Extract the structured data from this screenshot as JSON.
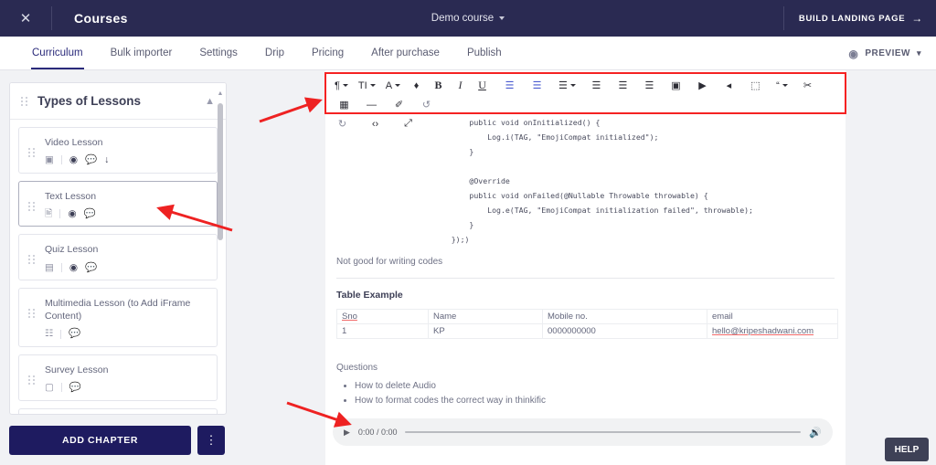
{
  "topbar": {
    "close_icon": "close-icon",
    "title": "Courses",
    "course_selector": "Demo course",
    "build_landing_page": "BUILD LANDING PAGE",
    "arrow_icon": "arrow-right-icon",
    "bg_color": "#2a2a52"
  },
  "nav": {
    "tabs": [
      {
        "label": "Curriculum",
        "active": true
      },
      {
        "label": "Bulk importer",
        "active": false
      },
      {
        "label": "Settings",
        "active": false
      },
      {
        "label": "Drip",
        "active": false
      },
      {
        "label": "Pricing",
        "active": false
      },
      {
        "label": "After purchase",
        "active": false
      },
      {
        "label": "Publish",
        "active": false
      }
    ],
    "preview_label": "PREVIEW",
    "preview_eye_icon": "eye-icon",
    "preview_chevron_icon": "chevron-down-icon",
    "accent_color": "#2a2a7a"
  },
  "sidebar": {
    "chapter_title": "Types of Lessons",
    "collapse_icon": "chevron-up-icon",
    "drag_icon": "drag-handle-icon",
    "lessons": [
      {
        "name": "Video Lesson",
        "selected": false,
        "icons": [
          "video-camera-icon",
          "eye-icon",
          "comment-icon",
          "download-icon"
        ]
      },
      {
        "name": "Text Lesson",
        "selected": true,
        "icons": [
          "document-icon",
          "eye-icon",
          "comment-icon"
        ]
      },
      {
        "name": "Quiz Lesson",
        "selected": false,
        "icons": [
          "quiz-icon",
          "eye-icon",
          "comment-icon"
        ]
      },
      {
        "name": "Multimedia Lesson (to Add iFrame Content)",
        "selected": false,
        "icons": [
          "multimedia-icon",
          "comment-icon"
        ]
      },
      {
        "name": "Survey Lesson",
        "selected": false,
        "icons": [
          "survey-icon",
          "comment-icon"
        ]
      }
    ],
    "add_chapter_label": "ADD CHAPTER",
    "kebab_icon": "more-vertical-icon"
  },
  "toolbar": {
    "highlight_color": "#f52222",
    "row1": [
      {
        "name": "paragraph-format-button",
        "glyph": "¶",
        "caret": true,
        "style": "dark"
      },
      {
        "name": "font-size-button",
        "glyph": "TІ",
        "caret": true,
        "style": "dark"
      },
      {
        "name": "font-family-button",
        "glyph": "A",
        "caret": true,
        "style": "dark"
      },
      {
        "name": "text-color-button",
        "glyph": "♦",
        "caret": false,
        "style": "dark"
      },
      {
        "name": "bold-button",
        "glyph": "B",
        "caret": false,
        "style": "dark"
      },
      {
        "name": "italic-button",
        "glyph": "I",
        "caret": false,
        "style": "dark"
      },
      {
        "name": "underline-button",
        "glyph": "U",
        "caret": false,
        "style": "dark"
      },
      {
        "name": "unordered-list-button",
        "glyph": "☰",
        "caret": false,
        "style": "blue"
      },
      {
        "name": "ordered-list-button",
        "glyph": "☰",
        "caret": false,
        "style": "blue"
      },
      {
        "name": "align-button",
        "glyph": "☰",
        "caret": true,
        "style": "dark"
      },
      {
        "name": "indent-increase-button",
        "glyph": "☰",
        "caret": false,
        "style": "dark"
      },
      {
        "name": "indent-decrease-button",
        "glyph": "☰",
        "caret": false,
        "style": "dark"
      },
      {
        "name": "outdent-button",
        "glyph": "☰",
        "caret": false,
        "style": "dark"
      },
      {
        "name": "insert-image-button",
        "glyph": "▣",
        "caret": false,
        "style": "dark"
      },
      {
        "name": "insert-video-button",
        "glyph": "▶",
        "caret": false,
        "style": "dark"
      },
      {
        "name": "insert-audio-button",
        "glyph": "◂",
        "caret": false,
        "style": "dark"
      },
      {
        "name": "insert-file-button",
        "glyph": "⬚",
        "caret": false,
        "style": "dark"
      },
      {
        "name": "quote-button",
        "glyph": "“",
        "caret": true,
        "style": "dark"
      },
      {
        "name": "insert-link-button",
        "glyph": "✂",
        "caret": false,
        "style": "dark"
      },
      {
        "name": "insert-table-button",
        "glyph": "▦",
        "caret": false,
        "style": "dark"
      },
      {
        "name": "horizontal-line-button",
        "glyph": "—",
        "caret": false,
        "style": "dark"
      },
      {
        "name": "clear-formatting-button",
        "glyph": "✐",
        "caret": false,
        "style": "dark"
      },
      {
        "name": "undo-button",
        "glyph": "↺",
        "caret": false,
        "style": "grey"
      }
    ],
    "row2": [
      {
        "name": "redo-button",
        "glyph": "↻",
        "caret": false,
        "style": "grey"
      },
      {
        "name": "code-view-button",
        "glyph": "‹›",
        "caret": false,
        "style": "dark"
      },
      {
        "name": "fullscreen-button",
        "glyph": "⤢",
        "caret": false,
        "style": "dark"
      }
    ]
  },
  "document": {
    "code": "        public void onInitialized() {\n            Log.i(TAG, \"EmojiCompat initialized\");\n        }\n\n        @Override\n        public void onFailed(@Nullable Throwable throwable) {\n            Log.e(TAG, \"EmojiCompat initialization failed\", throwable);\n        }\n    });)",
    "note": "Not good for writing codes",
    "table_heading": "Table Example",
    "table": {
      "headers": [
        "Sno",
        "Name",
        "Mobile no.",
        "email"
      ],
      "rows": [
        [
          "1",
          "KP",
          "0000000000",
          "hello@kripeshadwani.com"
        ]
      ]
    },
    "questions_heading": "Questions",
    "questions": [
      "How to delete Audio",
      "How to format codes the correct way in thinkific"
    ],
    "audio": {
      "play_icon": "play-icon",
      "time": "0:00 / 0:00",
      "volume_icon": "volume-icon"
    }
  },
  "help": {
    "label": "HELP"
  }
}
